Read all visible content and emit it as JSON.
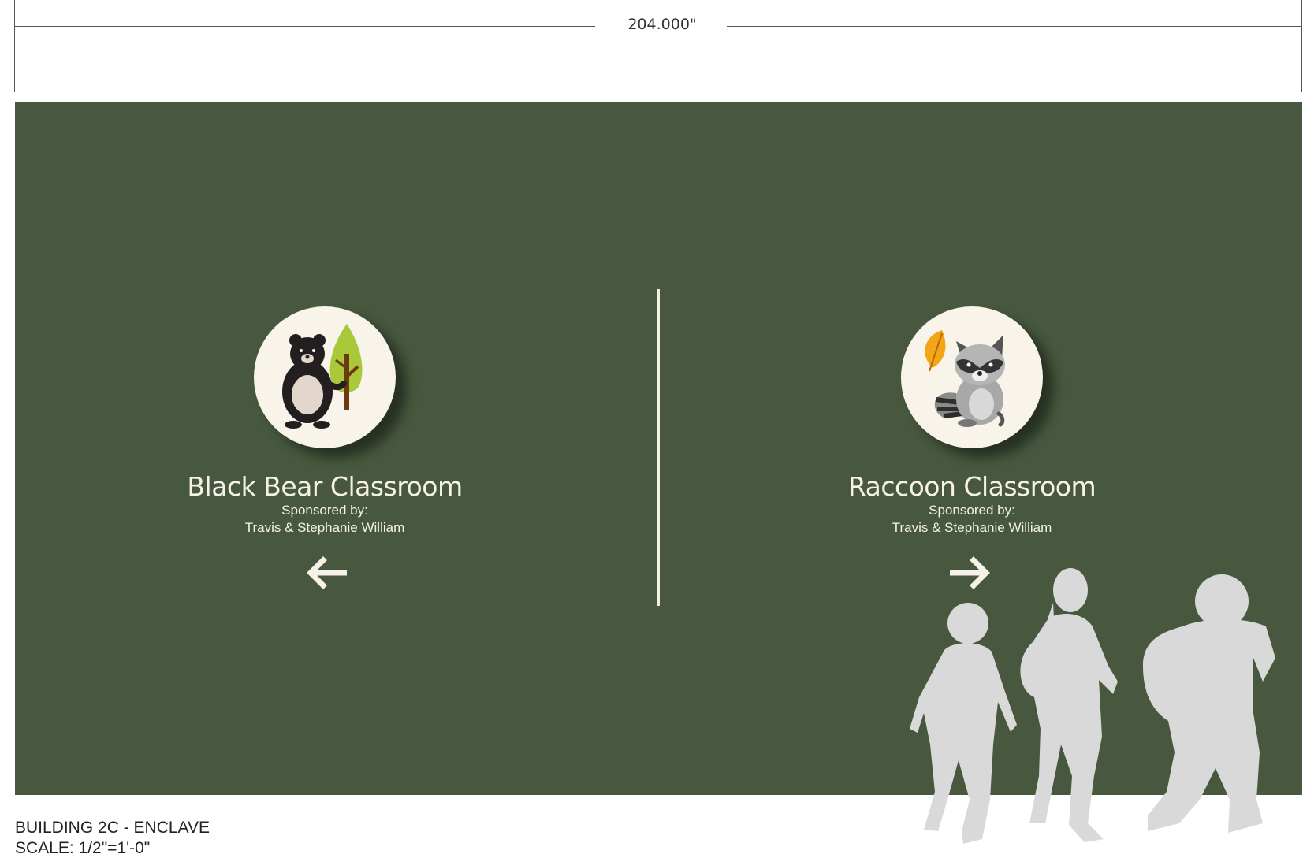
{
  "dimension": {
    "width_label": "204.000\""
  },
  "signs": [
    {
      "title": "Black Bear Classroom",
      "sponsor_label": "Sponsored by:",
      "sponsor_names": "Travis & Stephanie William",
      "icon": "black-bear-with-tree",
      "arrow": "arrow-left-icon"
    },
    {
      "title": "Raccoon Classroom",
      "sponsor_label": "Sponsored by:",
      "sponsor_names": "Travis & Stephanie William",
      "icon": "raccoon-with-leaf",
      "arrow": "arrow-right-icon"
    }
  ],
  "footer": {
    "building": "BUILDING 2C - ENCLAVE",
    "scale": "SCALE: 1/2\"=1'-0\""
  },
  "colors": {
    "wall": "#47583e",
    "cream": "#f8f4ea",
    "silhouette": "#d9d9d9"
  }
}
